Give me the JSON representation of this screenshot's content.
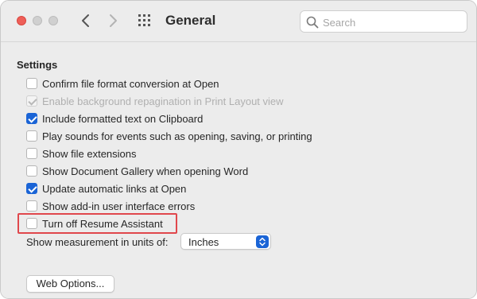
{
  "window": {
    "title": "General",
    "traffic_lights": {
      "close_color": "#ee5f58",
      "minimize_color": "#d0d0d0",
      "zoom_color": "#d0d0d0"
    }
  },
  "toolbar": {
    "back_icon": "chevron-left-icon",
    "forward_icon": "chevron-right-icon",
    "show_all_icon": "grid-icon"
  },
  "search": {
    "placeholder": "Search",
    "value": "",
    "icon": "search-icon"
  },
  "settings": {
    "heading": "Settings",
    "options": [
      {
        "label": "Confirm file format conversion at Open",
        "checked": false,
        "enabled": true
      },
      {
        "label": "Enable background repagination in Print Layout view",
        "checked": true,
        "enabled": false
      },
      {
        "label": "Include formatted text on Clipboard",
        "checked": true,
        "enabled": true
      },
      {
        "label": "Play sounds for events such as opening, saving, or printing",
        "checked": false,
        "enabled": true
      },
      {
        "label": "Show file extensions",
        "checked": false,
        "enabled": true
      },
      {
        "label": "Show Document Gallery when opening Word",
        "checked": false,
        "enabled": true
      },
      {
        "label": "Update automatic links at Open",
        "checked": true,
        "enabled": true
      },
      {
        "label": "Show add-in user interface errors",
        "checked": false,
        "enabled": true
      },
      {
        "label": "Turn off Resume Assistant",
        "checked": false,
        "enabled": true,
        "highlighted": true
      }
    ],
    "measurement": {
      "label": "Show measurement in units of:",
      "selected": "Inches"
    },
    "web_options_label": "Web Options..."
  },
  "colors": {
    "accent": "#1a64d6",
    "highlight_border": "#e0474c",
    "window_background": "#ececec"
  }
}
